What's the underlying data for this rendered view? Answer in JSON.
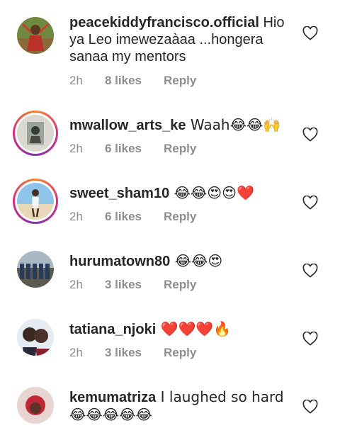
{
  "comments": [
    {
      "username": "peacekiddyfrancisco.official",
      "text": " Hio ya Leo imewezaàaa ...hongera sanaa my mentors",
      "time": "2h",
      "likes": "8 likes",
      "reply": "Reply",
      "avatar": "person-outdoors",
      "story_ring": false
    },
    {
      "username": "mwallow_arts_ke",
      "text": " Waah😂😂🙌",
      "time": "2h",
      "likes": "6 likes",
      "reply": "Reply",
      "avatar": "portrait-art",
      "story_ring": true
    },
    {
      "username": "sweet_sham10",
      "text": " 😂😂😍😍❤️",
      "time": "2h",
      "likes": "6 likes",
      "reply": "Reply",
      "avatar": "person-beach",
      "story_ring": true
    },
    {
      "username": "hurumatown80",
      "text": " 😂😂😍",
      "time": "2h",
      "likes": "3 likes",
      "reply": "Reply",
      "avatar": "group-photo",
      "story_ring": false
    },
    {
      "username": "tatiana_njoki",
      "text": " ❤️❤️❤️🔥",
      "time": "2h",
      "likes": "3 likes",
      "reply": "Reply",
      "avatar": "two-faces",
      "story_ring": false
    },
    {
      "username": "kemumatriza",
      "text": " I laughed so hard 😂😂😂😂😂",
      "time": "",
      "likes": "",
      "reply": "",
      "avatar": "person-red-hair",
      "story_ring": false
    }
  ],
  "icons": {
    "like": "heart-outline-icon"
  },
  "colors": {
    "text": "#262626",
    "meta": "#8e8e8e",
    "story_ring_start": "#f58529",
    "story_ring_end": "#8134af"
  }
}
